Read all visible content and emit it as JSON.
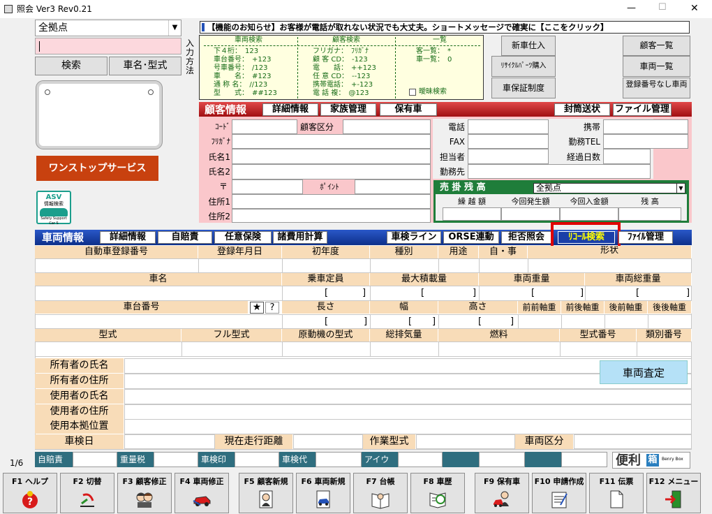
{
  "window": {
    "title": "照会 Ver3 Rev0.21",
    "minimize": "—",
    "maximize": "☐",
    "close": "✕"
  },
  "search": {
    "location": "全拠点",
    "query": "",
    "search_button": "検索",
    "model_button": "車名･型式",
    "input_method": "入力方法"
  },
  "onestop": "ワンストップサービス",
  "asv": {
    "line1": "ASV",
    "line2": "情報検索",
    "line3": "Safety Support Car S"
  },
  "notice": "【機能のお知らせ】お客様が電話が取れない状況でも大丈夫。ショートメッセージで確実に【ここをクリック】",
  "help": {
    "vehicle_title": "車両検索",
    "vehicle_lines": [
      "下４桁：　123",
      "車台番号：　+123",
      "号車番号：　/123",
      "車　　名：　#123",
      "通 称 名：　//123",
      "型　　式：　##123"
    ],
    "customer_title": "顧客検索",
    "customer_lines": [
      "フリガナ：　ﾌﾘｶﾞﾅ",
      "顧 客 CD：　-123",
      "電　　話：　++123",
      "任 意 CD：　--123",
      "携帯電話：　+-123",
      "電 話 複：　@123"
    ],
    "list_title": "一覧",
    "list_lines": [
      "客一覧：　*",
      "車一覧：　0"
    ],
    "fuzzy": "曖昧検索"
  },
  "side_buttons": [
    "新車仕入",
    "ﾘｻｲｸﾙﾊﾟｰﾂ購入",
    "車保証制度"
  ],
  "right_buttons": [
    "顧客一覧",
    "車両一覧",
    "登録番号なし車両"
  ],
  "customer": {
    "tab_main": "顧客情報",
    "tabs": [
      "詳細情報",
      "家族管理",
      "保有車"
    ],
    "tabs_right": [
      "封筒送状",
      "ファイル管理"
    ],
    "code": "ｺｰﾄﾞ",
    "category": "顧客区分",
    "kana": "ﾌﾘｶﾞﾅ",
    "name1": "氏名1",
    "name2": "氏名2",
    "zip": "〒",
    "point": "ﾎﾟｲﾝﾄ",
    "addr1": "住所1",
    "addr2": "住所2",
    "phone": "電話",
    "fax": "FAX",
    "staff": "担当者",
    "work": "勤務先",
    "mobile": "携帯",
    "work_tel": "勤務TEL",
    "days": "経過日数"
  },
  "receivable": {
    "title": "売 掛 残 高",
    "location": "全拠点",
    "cols": [
      "繰 越 額",
      "今回発生額",
      "今回入金額",
      "残 高"
    ]
  },
  "vehicle": {
    "tab_main": "車両情報",
    "tabs": [
      "詳細情報",
      "自賠責",
      "任意保険",
      "諸費用計算"
    ],
    "tabs_right": [
      "車検ライン",
      "ORSE連動",
      "拒否照会",
      "ﾘｺｰﾙ検索",
      "ﾌｧｲﾙ管理"
    ],
    "row1": [
      "自動車登録番号",
      "登録年月日",
      "初年度",
      "種別",
      "用途",
      "自・事",
      "形状"
    ],
    "row2": [
      "車名",
      "乗車定員",
      "最大積載量",
      "車両重量",
      "車両総重量"
    ],
    "row3": [
      "車台番号",
      "長さ",
      "幅",
      "高さ",
      "前前軸重",
      "前後軸重",
      "後前軸重",
      "後後軸重"
    ],
    "row4": [
      "型式",
      "フル型式",
      "原動機の型式",
      "総排気量",
      "燃料",
      "型式番号",
      "類別番号"
    ],
    "owner": [
      "所有者の氏名",
      "所有者の住所",
      "使用者の氏名",
      "使用者の住所",
      "使用本拠位置"
    ],
    "appraise": "車両査定",
    "row5": [
      "車検日",
      "現在走行距離",
      "作業型式",
      "車両区分"
    ],
    "star": "★",
    "question": "?"
  },
  "status": {
    "page": "1/6",
    "fields": [
      "自賠責",
      "重量税",
      "車検印",
      "車検代",
      "アイウ"
    ],
    "benri": "便利",
    "bako": "箱",
    "benry": "Benry Box"
  },
  "fkeys": [
    {
      "key": "F1",
      "label": "ヘルプ",
      "icon": "help-icon"
    },
    {
      "key": "F2",
      "label": "切替",
      "icon": "switch-icon"
    },
    {
      "key": "F3",
      "label": "顧客修正",
      "icon": "customers-icon"
    },
    {
      "key": "F4",
      "label": "車両修正",
      "icon": "car-icon"
    },
    {
      "key": "F5",
      "label": "顧客新規",
      "icon": "new-customer-icon"
    },
    {
      "key": "F6",
      "label": "車両新規",
      "icon": "new-vehicle-icon"
    },
    {
      "key": "F7",
      "label": "台帳",
      "icon": "ledger-icon"
    },
    {
      "key": "F8",
      "label": "車歴",
      "icon": "history-icon"
    },
    {
      "key": "F9",
      "label": "保有車",
      "icon": "owned-car-icon"
    },
    {
      "key": "F10",
      "label": "申請作成",
      "icon": "application-icon"
    },
    {
      "key": "F11",
      "label": "伝票",
      "icon": "slip-icon"
    },
    {
      "key": "F12",
      "label": "メニュー",
      "icon": "exit-icon"
    }
  ],
  "colors": {
    "pink": "#fac7cb",
    "red": "#b81c1f",
    "blue": "#1a3fa8",
    "green": "#1f7d3a",
    "yellow": "#ffffe0",
    "highlight": "#e00000"
  }
}
